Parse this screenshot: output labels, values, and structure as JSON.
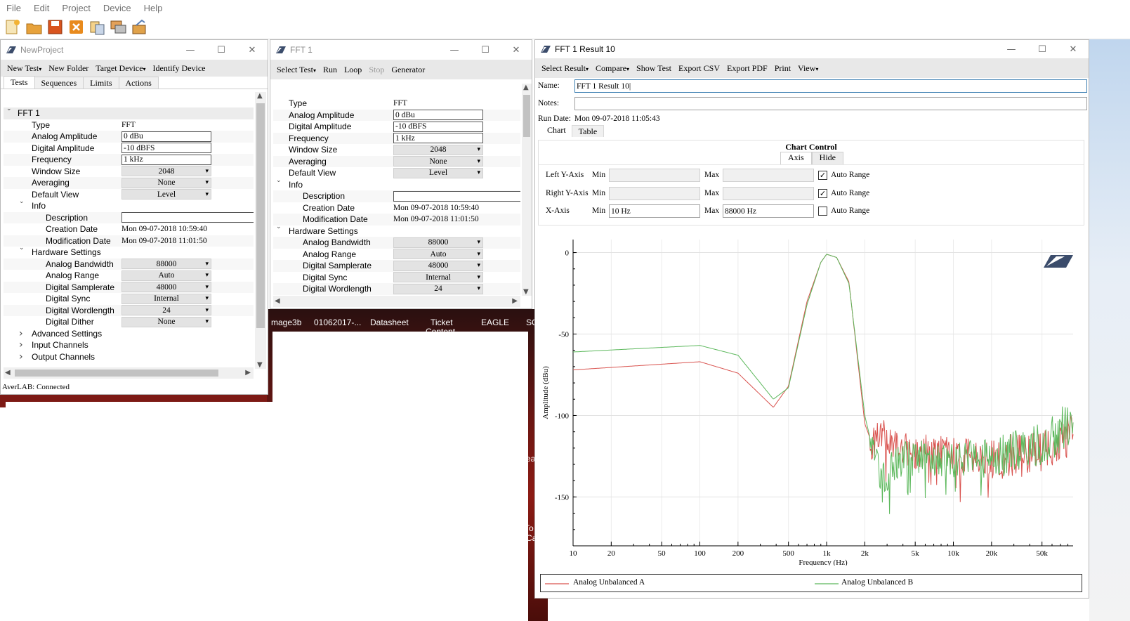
{
  "menu": [
    "File",
    "Edit",
    "Project",
    "Device",
    "Help"
  ],
  "toolbar_icons": [
    "new-project-icon",
    "open-folder-icon",
    "save-icon",
    "close-project-icon",
    "copy-icon",
    "windows-icon",
    "export-icon"
  ],
  "desktop": {
    "taskbar_labels": [
      "mage3b",
      "01062017-...",
      "Datasheet",
      "Ticket",
      "EAGLE",
      "SC"
    ],
    "taskbar_label_2": "Content",
    "side_labels": [
      "Tea",
      "To",
      "Ca"
    ]
  },
  "project_window": {
    "title": "NewProject",
    "commands": [
      "New Test",
      "New Folder",
      "Target Device",
      "Identify Device"
    ],
    "tabs": [
      "Tests",
      "Sequences",
      "Limits",
      "Actions"
    ],
    "tree_root": "FFT 1",
    "props": [
      {
        "label": "Type",
        "value": "FFT",
        "kind": "plain"
      },
      {
        "label": "Analog Amplitude",
        "value": "0 dBu",
        "kind": "box"
      },
      {
        "label": "Digital Amplitude",
        "value": "-10 dBFS",
        "kind": "box"
      },
      {
        "label": "Frequency",
        "value": "1 kHz",
        "kind": "box"
      },
      {
        "label": "Window Size",
        "value": "2048",
        "kind": "drop"
      },
      {
        "label": "Averaging",
        "value": "None",
        "kind": "drop"
      },
      {
        "label": "Default View",
        "value": "Level",
        "kind": "drop"
      }
    ],
    "info_label": "Info",
    "info_props": [
      {
        "label": "Description",
        "value": "",
        "kind": "box"
      },
      {
        "label": "Creation Date",
        "value": "Mon 09-07-2018 10:59:40",
        "kind": "plain"
      },
      {
        "label": "Modification Date",
        "value": "Mon 09-07-2018 11:01:50",
        "kind": "plain"
      }
    ],
    "hw_label": "Hardware Settings",
    "hw_props": [
      {
        "label": "Analog Bandwidth",
        "value": "88000",
        "kind": "drop"
      },
      {
        "label": "Analog Range",
        "value": "Auto",
        "kind": "drop"
      },
      {
        "label": "Digital Samplerate",
        "value": "48000",
        "kind": "drop"
      },
      {
        "label": "Digital Sync",
        "value": "Internal",
        "kind": "drop"
      },
      {
        "label": "Digital Wordlength",
        "value": "24",
        "kind": "drop"
      },
      {
        "label": "Digital Dither",
        "value": "None",
        "kind": "drop"
      }
    ],
    "collapsed_groups": [
      "Advanced Settings",
      "Input Channels",
      "Output Channels"
    ],
    "status": "AverLAB: Connected"
  },
  "fft_window": {
    "title": "FFT 1",
    "commands": [
      "Select Test",
      "Run",
      "Loop",
      "Stop",
      "Generator"
    ],
    "props": [
      {
        "label": "Type",
        "value": "FFT",
        "kind": "plain"
      },
      {
        "label": "Analog Amplitude",
        "value": "0 dBu",
        "kind": "box"
      },
      {
        "label": "Digital Amplitude",
        "value": "-10 dBFS",
        "kind": "box"
      },
      {
        "label": "Frequency",
        "value": "1 kHz",
        "kind": "box"
      },
      {
        "label": "Window Size",
        "value": "2048",
        "kind": "drop"
      },
      {
        "label": "Averaging",
        "value": "None",
        "kind": "drop"
      },
      {
        "label": "Default View",
        "value": "Level",
        "kind": "drop"
      }
    ],
    "info_label": "Info",
    "info_props": [
      {
        "label": "Description",
        "value": "",
        "kind": "box"
      },
      {
        "label": "Creation Date",
        "value": "Mon 09-07-2018 10:59:40",
        "kind": "plain"
      },
      {
        "label": "Modification Date",
        "value": "Mon 09-07-2018 11:01:50",
        "kind": "plain"
      }
    ],
    "hw_label": "Hardware Settings",
    "hw_props": [
      {
        "label": "Analog Bandwidth",
        "value": "88000",
        "kind": "drop"
      },
      {
        "label": "Analog Range",
        "value": "Auto",
        "kind": "drop"
      },
      {
        "label": "Digital Samplerate",
        "value": "48000",
        "kind": "drop"
      },
      {
        "label": "Digital Sync",
        "value": "Internal",
        "kind": "drop"
      },
      {
        "label": "Digital Wordlength",
        "value": "24",
        "kind": "drop"
      }
    ]
  },
  "result_window": {
    "title": "FFT 1 Result 10",
    "commands": [
      "Select Result",
      "Compare",
      "Show Test",
      "Export CSV",
      "Export PDF",
      "Print",
      "View"
    ],
    "name_label": "Name:",
    "name_value": "FFT 1 Result 10|",
    "notes_label": "Notes:",
    "notes_value": "",
    "run_date_label": "Run Date:",
    "run_date_value": "Mon 09-07-2018 11:05:43",
    "tabs": [
      "Chart",
      "Table"
    ],
    "chart_control": {
      "title": "Chart Control",
      "tabs": [
        "Axis",
        "Hide"
      ],
      "rows": [
        {
          "label": "Left Y-Axis",
          "min_label": "Min",
          "min": "",
          "max_label": "Max",
          "max": "",
          "auto_label": "Auto Range",
          "auto": true
        },
        {
          "label": "Right Y-Axis",
          "min_label": "Min",
          "min": "",
          "max_label": "Max",
          "max": "",
          "auto_label": "Auto Range",
          "auto": true
        },
        {
          "label": "X-Axis",
          "min_label": "Min",
          "min": "10 Hz",
          "max_label": "Max",
          "max": "88000 Hz",
          "auto_label": "Auto Range",
          "auto": false
        }
      ]
    }
  },
  "chart_data": {
    "type": "line",
    "xlabel": "Frequency (Hz)",
    "ylabel": "Amplitude (dBu)",
    "x_scale": "log",
    "xlim": [
      10,
      88000
    ],
    "ylim": [
      -180,
      8
    ],
    "x_ticks": [
      10,
      20,
      50,
      100,
      200,
      500,
      1000,
      2000,
      5000,
      10000,
      20000,
      50000
    ],
    "x_tick_labels": [
      "10",
      "20",
      "50",
      "100",
      "200",
      "500",
      "1k",
      "2k",
      "5k",
      "10k",
      "20k",
      "50k"
    ],
    "y_ticks": [
      0,
      -50,
      -100,
      -150
    ],
    "y_tick_labels": [
      "0",
      "-50",
      "-100",
      "-150"
    ],
    "grid": true,
    "legend": "bottom",
    "series": [
      {
        "name": "Analog Unbalanced A",
        "color": "#d9534f",
        "x": [
          10,
          100,
          200,
          380,
          500,
          700,
          900,
          1000,
          1200,
          1500,
          2000,
          2300,
          2800,
          3500,
          5000,
          10000,
          20000,
          40000,
          60000,
          80000
        ],
        "y": [
          -72,
          -67,
          -74,
          -95,
          -82,
          -30,
          -6,
          -1,
          -3,
          -18,
          -105,
          -118,
          -112,
          -120,
          -122,
          -124,
          -126,
          -123,
          -118,
          -112
        ]
      },
      {
        "name": "Analog Unbalanced B",
        "color": "#5cb85c",
        "x": [
          10,
          100,
          200,
          380,
          500,
          700,
          900,
          1000,
          1200,
          1500,
          2000,
          2300,
          2800,
          3500,
          5000,
          10000,
          20000,
          40000,
          60000,
          80000
        ],
        "y": [
          -61,
          -57,
          -63,
          -90,
          -83,
          -32,
          -6,
          -1,
          -3,
          -19,
          -100,
          -120,
          -140,
          -128,
          -126,
          -127,
          -125,
          -120,
          -113,
          -106
        ]
      }
    ]
  }
}
